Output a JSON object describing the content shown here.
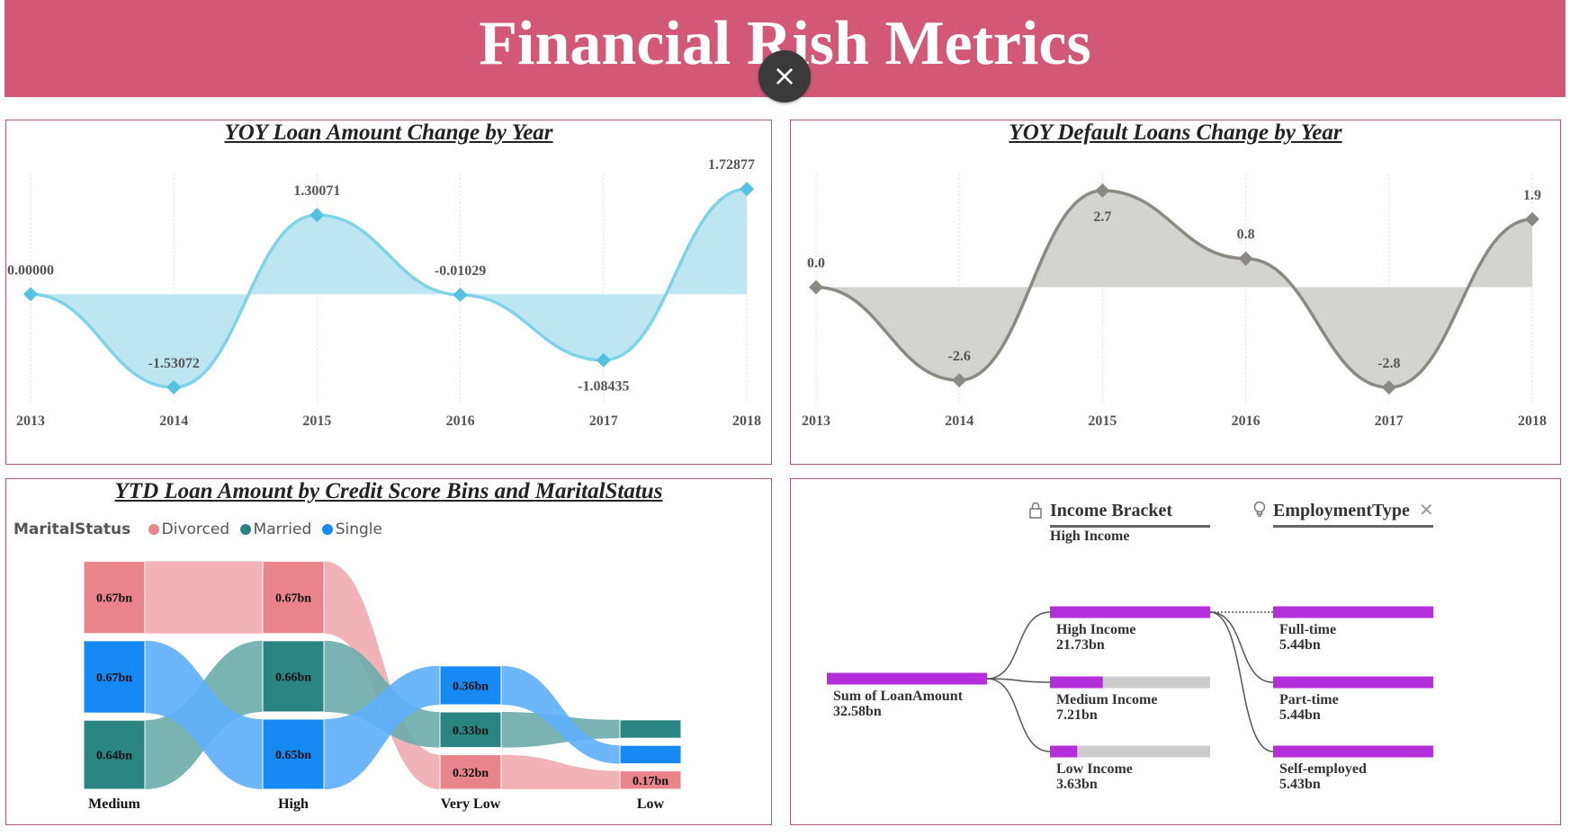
{
  "header": {
    "title": "Financial Rish Metrics",
    "close_label": "×",
    "close_icon": "close-icon"
  },
  "colors": {
    "banner": "#d35878",
    "loan_line": "#7fd3e8",
    "loan_fill": "#bde6f2",
    "loan_marker": "#52c2e0",
    "default_line": "#8a8a82",
    "default_fill": "#d3d4d0",
    "divorced": "#e8848a",
    "married": "#2a8582",
    "single": "#1789f5",
    "decomp_bar": "#b22fd9",
    "decomp_track": "#cccccc"
  },
  "loan_chart": {
    "title": "YOY Loan Amount Change by Year",
    "chart_data": {
      "type": "area",
      "title": "YOY Loan Amount Change by Year",
      "x": [
        "2013",
        "2014",
        "2015",
        "2016",
        "2017",
        "2018"
      ],
      "values": [
        0.0,
        -1.53072,
        1.30071,
        -0.01029,
        -1.08435,
        1.72877
      ],
      "labels": [
        "0.00000",
        "-1.53072",
        "1.30071",
        "-0.01029",
        "-1.08435",
        "1.72877"
      ],
      "ylim": [
        -1.65,
        1.85
      ],
      "grid": "vertical-dotted"
    }
  },
  "default_chart": {
    "title": "YOY Default Loans Change by Year",
    "chart_data": {
      "type": "area",
      "title": "YOY Default Loans Change by Year",
      "x": [
        "2013",
        "2014",
        "2015",
        "2016",
        "2017",
        "2018"
      ],
      "values": [
        0.0,
        -2.6,
        2.7,
        0.8,
        -2.8,
        1.9
      ],
      "labels": [
        "0.0",
        "-2.6",
        "2.7",
        "0.8",
        "-2.8",
        "1.9"
      ],
      "ylim": [
        -3.0,
        2.95
      ],
      "grid": "vertical-dotted"
    }
  },
  "ribbon_chart": {
    "title": "YTD Loan Amount by Credit Score Bins and MaritalStatus",
    "legend_title": "MaritalStatus",
    "legend": [
      "Divorced",
      "Married",
      "Single"
    ],
    "chart_data": {
      "type": "ribbon",
      "categories": [
        "Medium",
        "High",
        "Very Low",
        "Low"
      ],
      "series": [
        {
          "name": "Divorced",
          "values": [
            0.67,
            0.67,
            0.32,
            0.17
          ],
          "labels": [
            "0.67bn",
            "0.67bn",
            "0.32bn",
            "0.17bn"
          ]
        },
        {
          "name": "Married",
          "values": [
            0.64,
            0.66,
            0.33,
            0.17
          ],
          "labels": [
            "0.64bn",
            "0.66bn",
            "0.33bn",
            ""
          ]
        },
        {
          "name": "Single",
          "values": [
            0.67,
            0.65,
            0.36,
            0.17
          ],
          "labels": [
            "0.67bn",
            "0.65bn",
            "0.36bn",
            ""
          ]
        }
      ]
    }
  },
  "decomp": {
    "income_header": "Income Bracket",
    "income_sub": "High Income",
    "employment_header": "EmploymentType",
    "root": {
      "label": "Sum of LoanAmount",
      "value": "32.58bn"
    },
    "income": [
      {
        "label": "High Income",
        "value": "21.73bn",
        "fraction": 1.0
      },
      {
        "label": "Medium Income",
        "value": "7.21bn",
        "fraction": 0.33
      },
      {
        "label": "Low Income",
        "value": "3.63bn",
        "fraction": 0.17
      }
    ],
    "employment": [
      {
        "label": "Full-time",
        "value": "5.44bn",
        "fraction": 1.0
      },
      {
        "label": "Part-time",
        "value": "5.44bn",
        "fraction": 1.0
      },
      {
        "label": "Self-employed",
        "value": "5.43bn",
        "fraction": 1.0
      }
    ]
  }
}
